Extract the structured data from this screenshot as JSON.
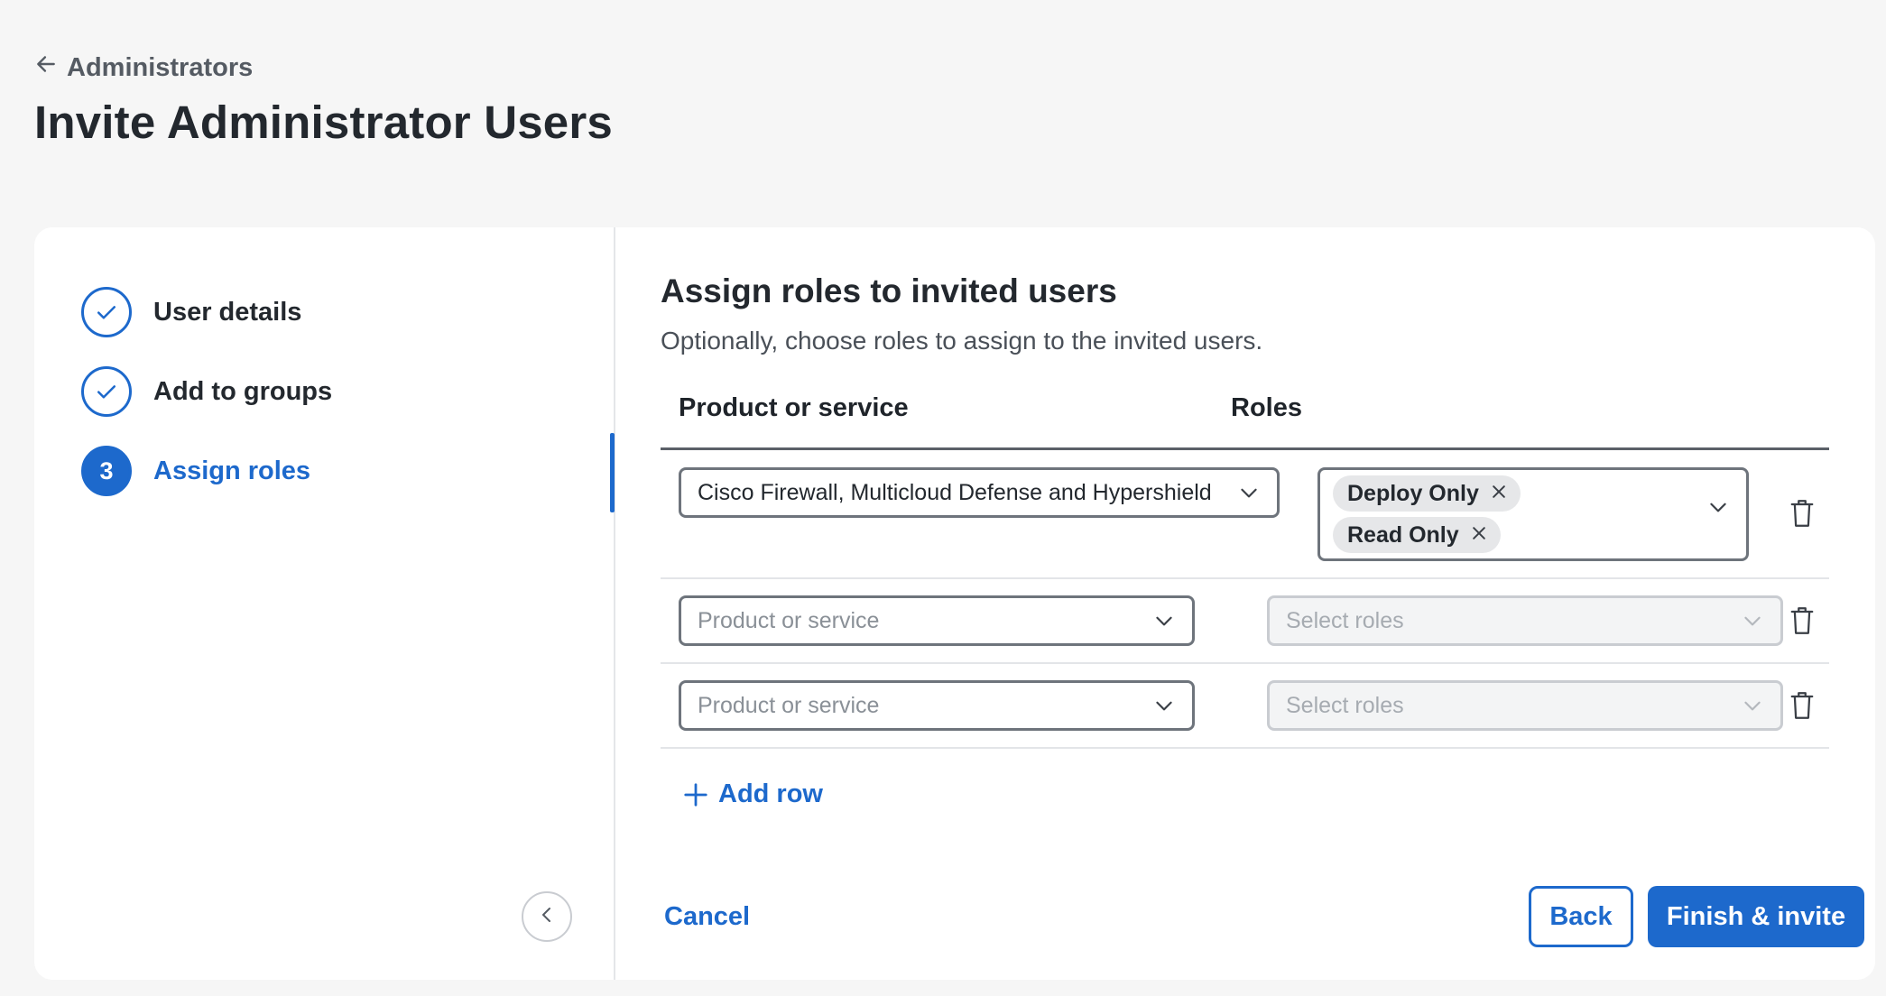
{
  "header": {
    "breadcrumb": "Administrators",
    "title": "Invite Administrator Users"
  },
  "steps": [
    {
      "label": "User details",
      "status": "complete"
    },
    {
      "label": "Add to groups",
      "status": "complete"
    },
    {
      "label": "Assign roles",
      "status": "current",
      "number": "3"
    }
  ],
  "main": {
    "title": "Assign roles to invited users",
    "subtitle": "Optionally, choose roles to assign to the invited users.",
    "columns": {
      "product": "Product or service",
      "roles": "Roles"
    },
    "rows": [
      {
        "product": "Cisco Firewall, Multicloud Defense and Hypershield",
        "roles": [
          "Deploy Only",
          "Read Only"
        ]
      },
      {
        "product_placeholder": "Product or service",
        "roles_placeholder": "Select roles"
      },
      {
        "product_placeholder": "Product or service",
        "roles_placeholder": "Select roles"
      }
    ],
    "add_row": "Add row"
  },
  "footer": {
    "cancel": "Cancel",
    "back": "Back",
    "finish": "Finish & invite"
  },
  "colors": {
    "accent": "#1d69cc",
    "background": "#f6f6f6",
    "card": "#ffffff"
  }
}
